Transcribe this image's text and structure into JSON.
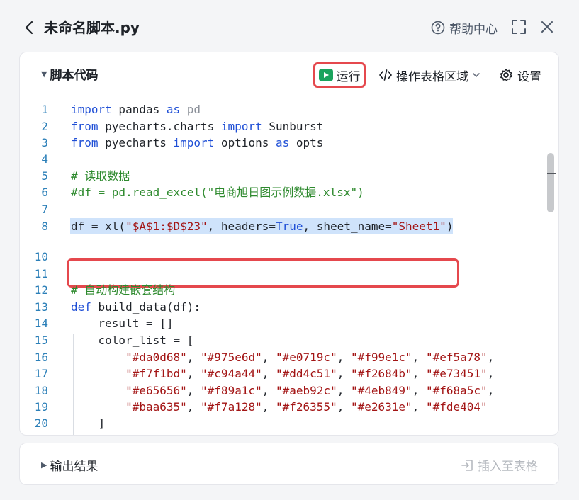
{
  "window": {
    "title": "未命名脚本.py",
    "help_label": "帮助中心"
  },
  "code_panel": {
    "title": "脚本代码",
    "run_label": "运行",
    "range_label": "操作表格区域",
    "settings_label": "设置"
  },
  "code_lines": [
    {
      "num": "1",
      "tokens": [
        {
          "t": "k",
          "v": "import"
        },
        {
          "t": "n",
          "v": " pandas "
        },
        {
          "t": "k",
          "v": "as"
        },
        {
          "t": "m",
          "v": " pd"
        }
      ]
    },
    {
      "num": "2",
      "tokens": [
        {
          "t": "k",
          "v": "from"
        },
        {
          "t": "n",
          "v": " pyecharts.charts "
        },
        {
          "t": "k",
          "v": "import"
        },
        {
          "t": "n",
          "v": " Sunburst"
        }
      ]
    },
    {
      "num": "3",
      "tokens": [
        {
          "t": "k",
          "v": "from"
        },
        {
          "t": "n",
          "v": " pyecharts "
        },
        {
          "t": "k",
          "v": "import"
        },
        {
          "t": "n",
          "v": " options "
        },
        {
          "t": "k",
          "v": "as"
        },
        {
          "t": "n",
          "v": " opts"
        }
      ]
    },
    {
      "num": "4",
      "tokens": []
    },
    {
      "num": "5",
      "tokens": [
        {
          "t": "c",
          "v": "# 读取数据"
        }
      ]
    },
    {
      "num": "6",
      "tokens": [
        {
          "t": "c",
          "v": "#df = pd.read_excel(\"电商旭日图示例数据.xlsx\")"
        }
      ]
    },
    {
      "num": "7",
      "tokens": []
    },
    {
      "num": "8",
      "tokens": [
        {
          "t": "n",
          "v": "df = xl("
        },
        {
          "t": "s",
          "v": "\"$A$1:$D$23\""
        },
        {
          "t": "n",
          "v": ", headers="
        },
        {
          "t": "k",
          "v": "True"
        },
        {
          "t": "n",
          "v": ", sheet_name="
        },
        {
          "t": "s",
          "v": "\"Sheet1\""
        },
        {
          "t": "n",
          "v": ")"
        }
      ],
      "selected": true
    },
    {
      "num": "10",
      "tokens": []
    },
    {
      "num": "11",
      "tokens": []
    },
    {
      "num": "12",
      "tokens": [
        {
          "t": "c",
          "v": "# 自动构建嵌套结构"
        }
      ]
    },
    {
      "num": "13",
      "tokens": [
        {
          "t": "k",
          "v": "def"
        },
        {
          "t": "n",
          "v": " build_data(df):"
        }
      ]
    },
    {
      "num": "14",
      "tokens": [
        {
          "t": "n",
          "v": "    result = []"
        }
      ]
    },
    {
      "num": "15",
      "tokens": [
        {
          "t": "n",
          "v": "    color_list = ["
        }
      ]
    },
    {
      "num": "16",
      "tokens": [
        {
          "t": "n",
          "v": "        "
        },
        {
          "t": "s",
          "v": "\"#da0d68\""
        },
        {
          "t": "n",
          "v": ", "
        },
        {
          "t": "s",
          "v": "\"#975e6d\""
        },
        {
          "t": "n",
          "v": ", "
        },
        {
          "t": "s",
          "v": "\"#e0719c\""
        },
        {
          "t": "n",
          "v": ", "
        },
        {
          "t": "s",
          "v": "\"#f99e1c\""
        },
        {
          "t": "n",
          "v": ", "
        },
        {
          "t": "s",
          "v": "\"#ef5a78\""
        },
        {
          "t": "n",
          "v": ","
        }
      ]
    },
    {
      "num": "17",
      "tokens": [
        {
          "t": "n",
          "v": "        "
        },
        {
          "t": "s",
          "v": "\"#f7f1bd\""
        },
        {
          "t": "n",
          "v": ", "
        },
        {
          "t": "s",
          "v": "\"#c94a44\""
        },
        {
          "t": "n",
          "v": ", "
        },
        {
          "t": "s",
          "v": "\"#dd4c51\""
        },
        {
          "t": "n",
          "v": ", "
        },
        {
          "t": "s",
          "v": "\"#f2684b\""
        },
        {
          "t": "n",
          "v": ", "
        },
        {
          "t": "s",
          "v": "\"#e73451\""
        },
        {
          "t": "n",
          "v": ","
        }
      ]
    },
    {
      "num": "18",
      "tokens": [
        {
          "t": "n",
          "v": "        "
        },
        {
          "t": "s",
          "v": "\"#e65656\""
        },
        {
          "t": "n",
          "v": ", "
        },
        {
          "t": "s",
          "v": "\"#f89a1c\""
        },
        {
          "t": "n",
          "v": ", "
        },
        {
          "t": "s",
          "v": "\"#aeb92c\""
        },
        {
          "t": "n",
          "v": ", "
        },
        {
          "t": "s",
          "v": "\"#4eb849\""
        },
        {
          "t": "n",
          "v": ", "
        },
        {
          "t": "s",
          "v": "\"#f68a5c\""
        },
        {
          "t": "n",
          "v": ","
        }
      ]
    },
    {
      "num": "19",
      "tokens": [
        {
          "t": "n",
          "v": "        "
        },
        {
          "t": "s",
          "v": "\"#baa635\""
        },
        {
          "t": "n",
          "v": ", "
        },
        {
          "t": "s",
          "v": "\"#f7a128\""
        },
        {
          "t": "n",
          "v": ", "
        },
        {
          "t": "s",
          "v": "\"#f26355\""
        },
        {
          "t": "n",
          "v": ", "
        },
        {
          "t": "s",
          "v": "\"#e2631e\""
        },
        {
          "t": "n",
          "v": ", "
        },
        {
          "t": "s",
          "v": "\"#fde404\""
        }
      ]
    },
    {
      "num": "20",
      "tokens": [
        {
          "t": "n",
          "v": "    ]"
        }
      ]
    }
  ],
  "output_panel": {
    "title": "输出结果",
    "insert_label": "插入至表格"
  },
  "colors": {
    "accent_run": "#1aa35d",
    "highlight_border": "#e5484d",
    "keyword": "#1f4fd6",
    "string": "#a31515",
    "comment": "#2e8a2e"
  }
}
